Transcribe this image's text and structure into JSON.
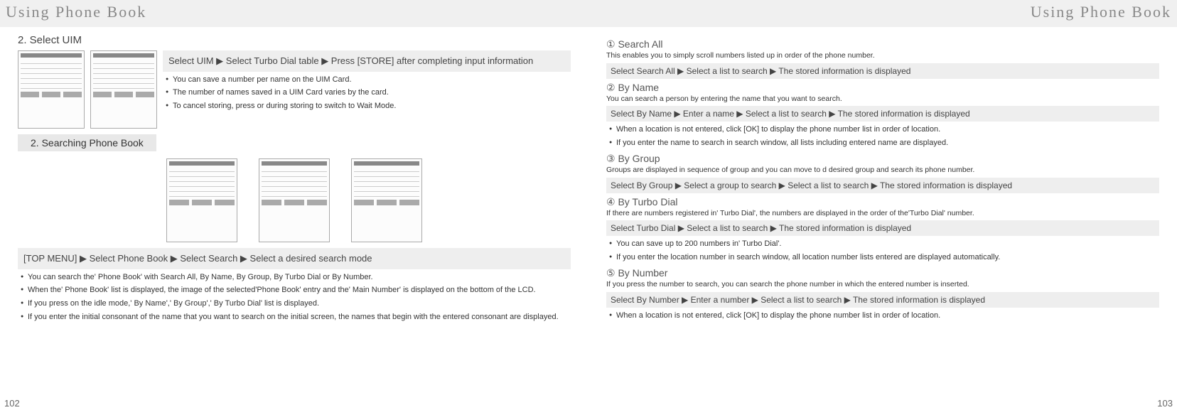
{
  "header": {
    "left_title": "Using Phone Book",
    "right_title": "Using Phone Book"
  },
  "left": {
    "subhead": "2. Select UIM",
    "greybar_full": "Select UIM ▶ Select Turbo Dial table ▶ Press    [STORE] after completing input information",
    "bullets1": [
      "You can save a number per name on the UIM Card.",
      "The number of names saved in a UIM Card varies by the card.",
      "To cancel storing, press         or         during storing to switch to Wait Mode."
    ],
    "section2": "2. Searching Phone Book",
    "greybar2": "   [TOP MENU] ▶ Select Phone Book ▶ Select Search ▶ Select a desired search mode",
    "bullets2": [
      "You can search the' Phone Book' with Search All, By Name, By Group, By Turbo Dial or By Number.",
      "When the' Phone Book' list is displayed, the image of the selected'Phone Book' entry and the' Main Number' is displayed on the bottom of the LCD.",
      "If you press        on the idle mode,' By Name',' By Group',' By Turbo Dial' list is displayed.",
      "If you enter the initial consonant of the name that you want to search on the initial screen, the names that begin with the entered consonant are displayed."
    ],
    "pagefoot": "102"
  },
  "right": {
    "items": [
      {
        "title": "① Search All",
        "desc": "This enables you to simply scroll numbers listed up in order of the phone number.",
        "bar": "Select Search All ▶ Select a list to search ▶ The stored information is displayed",
        "bullets": []
      },
      {
        "title": "② By Name",
        "desc": "You can search a person by entering the name that you want to search.",
        "bar": "Select By Name ▶ Enter a name ▶ Select a list to search ▶ The stored information is displayed",
        "bullets": [
          "When a location is not entered, click     [OK] to display the phone number list in order of location.",
          "If you enter the name to search in search window, all lists including entered name are displayed."
        ]
      },
      {
        "title": "③ By Group",
        "desc": "Groups are displayed in sequence of group and you can move to d desired group and search its phone number.",
        "bar": "Select By Group ▶ Select a group to search ▶ Select a list to search ▶ The stored information is displayed",
        "bullets": []
      },
      {
        "title": "④ By Turbo Dial",
        "desc": "If there are numbers registered in' Turbo Dial', the numbers are displayed in the order of the'Turbo Dial' number.",
        "bar": "Select Turbo Dial ▶ Select a list to search ▶ The stored information is displayed",
        "bullets": [
          "You can save up to 200 numbers in' Turbo Dial'.",
          "If you enter the location number in search window, all location number lists entered are displayed automatically."
        ]
      },
      {
        "title": "⑤ By Number",
        "desc": "If you press the number to search, you can search the phone number in which the entered number is inserted.",
        "bar": "Select By Number ▶ Enter a number ▶ Select a list to search ▶ The stored information is displayed",
        "bullets": [
          "When a location is not entered, click     [OK] to display the phone number list in order of location."
        ]
      }
    ],
    "pagefoot": "103"
  }
}
